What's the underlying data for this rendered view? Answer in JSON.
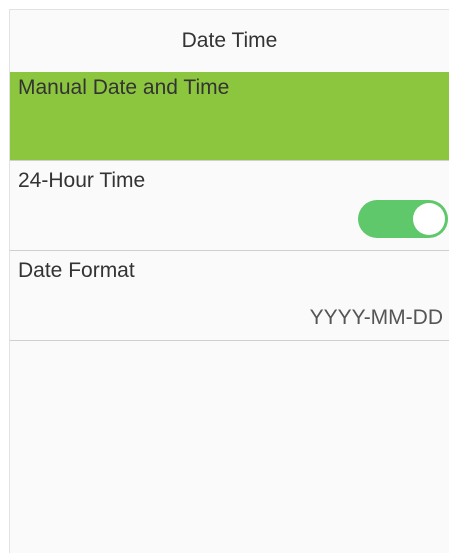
{
  "header": {
    "title": "Date Time"
  },
  "menu": {
    "manual": {
      "label": "Manual Date and Time"
    },
    "hour24": {
      "label": "24-Hour Time",
      "enabled": true
    },
    "date_format": {
      "label": "Date Format",
      "value": "YYYY-MM-DD"
    }
  },
  "colors": {
    "selected_background": "#8cc63f",
    "toggle_on": "#5fc86a"
  }
}
